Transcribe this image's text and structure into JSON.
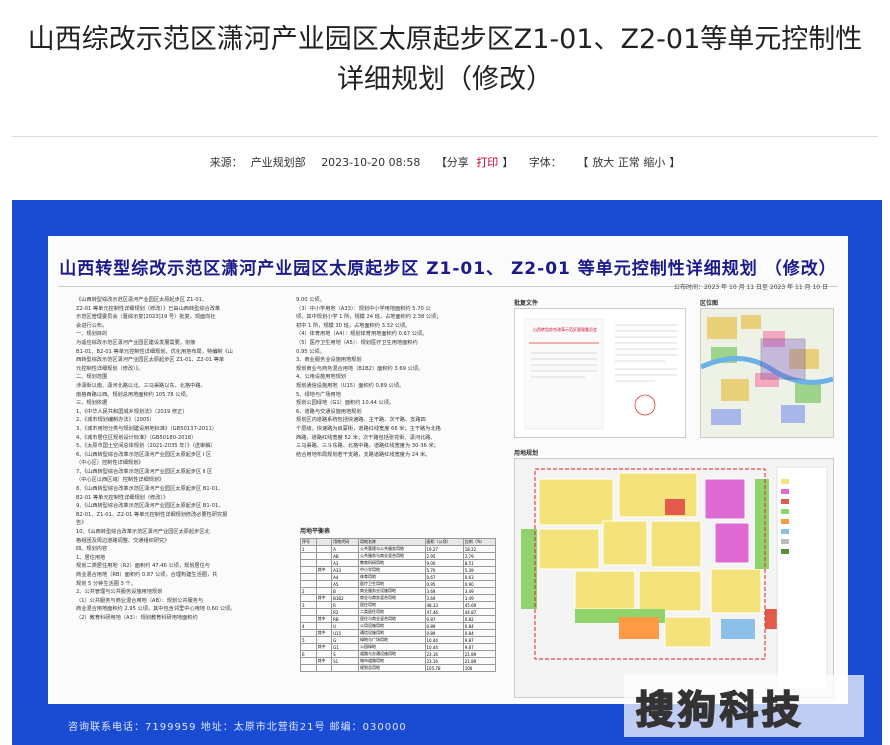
{
  "article": {
    "title": "山西综改示范区潇河产业园区太原起步区Z1-01、Z2-01等单元控制性详细规划（修改）",
    "source_label": "来源：",
    "source": "产业规划部",
    "date": "2023-10-20 08:58",
    "share_prefix": "【分享",
    "print_label": "打印",
    "share_suffix": "】",
    "font_label": "字体：",
    "font_prefix": "【",
    "font_large": "放大",
    "font_normal": "正常",
    "font_small": "缩小",
    "font_suffix": "】"
  },
  "poster": {
    "title": "山西转型综改示范区潇河产业园区太原起步区 Z1-01、 Z2-01 等单元控制性详细规划 （修改）",
    "notice_date": "公布时间：2023 年 10 月 11 日至 2023 年 11 月 10 日",
    "col1": [
      "《山西转型综改示范区潇河产业园区太原起步区 Z1-01、",
      "Z2-01 等单元控制性详细规划（修改）》已由山西转型综合改革",
      "示范区管理委员会（晋综示复[2023]19 号）批复，现面向社",
      "会进行公布。",
      "一、规划目的",
      "为适应综改示范区潇河产业园区建设发展需要，衔接",
      "B1-01、B2-01 等单元控制性详细规划，优化用地布局，特编制《山",
      "西转型综改示范区潇河产业园区太原起步区 Z1-01、Z2-01 等单",
      "元控制性详细规划（修改）》。",
      "二、规划范围",
      "涉潇街以南、潇河北路以北、三马渠路以东、北格中路、",
      "南格西路以西。规划总用地面积约 105.78 公顷。",
      "三、规划依据",
      "1、《中华人民共和国城乡规划法》（2019 修正）",
      "2、《城市规划编制办法》（2005）",
      "3、《城市用地分类与规划建设用地标准》（GB50137-2011）",
      "4、《城市居住区规划设计标准》（GB50180-2018）",
      "5、《太原市国土空间总体规划（2021-2035 年）》（送审稿）",
      "6、《山西转型综合改革示范区潇河产业园区太原起步区 Ⅰ 区",
      "（中心区）控制性详细规划》",
      "7、《山西转型综合改革示范区潇河产业园区太原起步区 Ⅱ 区",
      "（中心区以西区域）控制性详细规划》",
      "8、《山西转型综合改革示范区潇河产业园区太原起步区 B1-01、",
      "B2-01 等单元控制性详细规划（修改）》",
      "9、《山西转型综合改革示范区潇河产业园区太原起步区 B1-01、",
      "B2-01、Z1-01、Z2-01 等单元控制性详细规划修改必要性研究报",
      "告》",
      "10、《山西转型综合改革示范区潇河产业园区太原起步区北",
      "格组团及周边道路调整、交通组织研究》",
      "四、规划内容",
      "1、居住用地",
      "规划二类居住用地（R2）面积约 47.46 公顷，规划居住与",
      "商业混合用地（RB）面积约 0.87 公顷，合理构建生活圈，共",
      "规划 5 分钟生活圈 3 个。",
      "2、公共管理与公共服务设施用地规划",
      "（1）公共服务与商业混合用地（AB）：规划公共服务与",
      "商业混合用地面积约 2.95 公顷，其中包含邻里中心用地 0.60 公顷。",
      "（2）教育科研用地（A3）：规划教育科研用地面积约"
    ],
    "col2": [
      "9.00 公顷。",
      "（3）中小学用地（A33）：规划中小学用地面积约 5.70 公",
      "顷，其中规划小学 1 所，规模 24 班，占地面积约 2.38 公顷；",
      "初中 1 所，规模 30 班，占地面积约 3.32 公顷。",
      "（4）体育用地（A4）：规划体育用地面积约 0.67 公顷。",
      "（5）医疗卫生用地（A5）：规划医疗卫生用地面积约",
      "0.95 公顷。",
      "3、商业服务业设施用地规划",
      "规划商业与商务混合用地（B1B2）面积约 3.69 公顷。",
      "4、公用设施用地规划",
      "规划通信设施用地（U15）面积约 0.89 公顷。",
      "5、绿地与广场用地",
      "规划公园绿地（G1）面积约 10.44 公顷。",
      "6、道路与交通设施用地规划",
      "规划区内道路系统包括快速路、主干路、次干路、支路四",
      "个层级。快速路为启蒙街，道路红线宽度 66 米；主干路为北格",
      "西路，道路红线宽度 52 米；次干路包括张花街、潇河北路、",
      "三马渠路、三斗东路、北格中路，道路红线宽度为 30-36 米；",
      "结合用地布局规划若干支路，支路道路红线宽度为 24 米。"
    ],
    "table_title": "用地平衡表",
    "table_header": [
      "序号",
      "",
      "用地代码",
      "用地名称",
      "面积（公顷）",
      "比例（%）"
    ],
    "table_rows": [
      [
        "1",
        "",
        "A",
        "公共管理与公共服务用地",
        "19.27",
        "18.22"
      ],
      [
        "",
        "",
        "AB",
        "公共服务与商业混合用地",
        "2.95",
        "2.79"
      ],
      [
        "",
        "",
        "A3",
        "教育科研用地",
        "9.00",
        "8.51"
      ],
      [
        "",
        "其中",
        "A33",
        "中小学用地",
        "5.70",
        "5.39"
      ],
      [
        "",
        "",
        "A4",
        "体育用地",
        "0.67",
        "0.63"
      ],
      [
        "",
        "",
        "A5",
        "医疗卫生用地",
        "0.95",
        "0.90"
      ],
      [
        "2",
        "",
        "B",
        "商业服务业设施用地",
        "3.69",
        "3.49"
      ],
      [
        "",
        "其中",
        "B1B2",
        "商业与商务混合用地",
        "3.69",
        "3.49"
      ],
      [
        "3",
        "",
        "R",
        "居住用地",
        "48.33",
        "45.69"
      ],
      [
        "",
        "",
        "R2",
        "二类居住用地",
        "47.46",
        "44.87"
      ],
      [
        "",
        "其中",
        "RB",
        "居住与商业混合用地",
        "0.87",
        "0.82"
      ],
      [
        "4",
        "",
        "U",
        "公用设施用地",
        "0.89",
        "0.84"
      ],
      [
        "",
        "其中",
        "U15",
        "通信设施用地",
        "0.89",
        "0.84"
      ],
      [
        "5",
        "",
        "G",
        "绿地与广场用地",
        "10.44",
        "9.87"
      ],
      [
        "",
        "其中",
        "G1",
        "公园绿地",
        "10.44",
        "9.87"
      ],
      [
        "6",
        "",
        "S",
        "道路与交通设施用地",
        "23.16",
        "21.89"
      ],
      [
        "",
        "其中",
        "S1",
        "城市道路用地",
        "23.16",
        "21.89"
      ],
      [
        "",
        "",
        "",
        "规划总用地",
        "105.78",
        "100"
      ]
    ],
    "approval_label": "批复文件",
    "approval_header": "山西转型综合改革示范区管理委员会",
    "location_label": "区位图",
    "landuse_label": "用地规划",
    "footer": "咨询联系电话：7199959     地址：太原市北营街21号     邮编：030000"
  },
  "watermark": {
    "text": "搜狗科技"
  },
  "colors": {
    "poster_blue": "#1a4bd3",
    "title_red": "#c8002a",
    "poster_title": "#1a1a8a"
  }
}
